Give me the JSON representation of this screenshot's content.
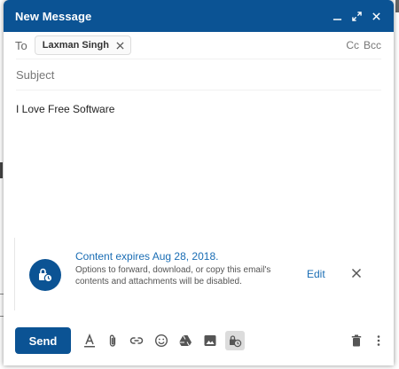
{
  "window": {
    "title": "New Message"
  },
  "recipients": {
    "to_label": "To",
    "chips": [
      {
        "name": "Laxman Singh"
      }
    ],
    "cc_label": "Cc",
    "bcc_label": "Bcc"
  },
  "subject": {
    "placeholder": "Subject",
    "value": ""
  },
  "body": {
    "text": "I Love Free Software"
  },
  "confidential": {
    "title": "Content expires Aug 28, 2018.",
    "description": "Options to forward, download, or copy this email's contents and attachments will be disabled.",
    "edit_label": "Edit"
  },
  "toolbar": {
    "send_label": "Send",
    "icons": [
      "format-text-icon",
      "attach-icon",
      "link-icon",
      "emoji-icon",
      "drive-icon",
      "photo-icon",
      "confidential-mode-icon",
      "trash-icon",
      "more-icon"
    ]
  },
  "colors": {
    "accent": "#0b5394",
    "link": "#1a6db4"
  }
}
